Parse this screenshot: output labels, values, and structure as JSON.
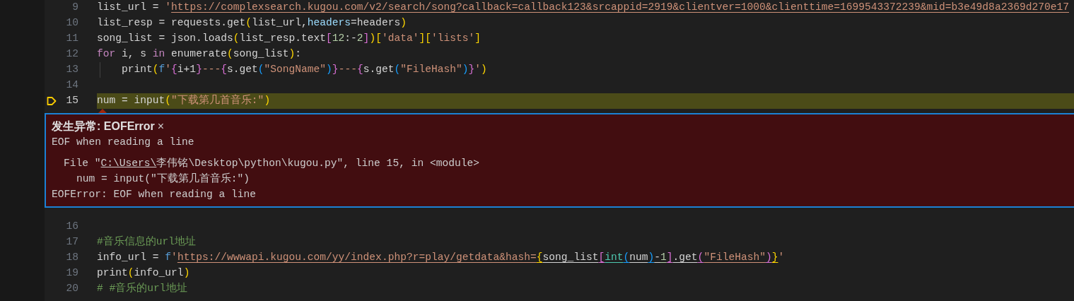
{
  "editor": {
    "lines_before": [
      {
        "number": "9",
        "current": false,
        "indent_guide": false,
        "segments": [
          {
            "text": "list_url = ",
            "kind": "plain"
          },
          {
            "text": "'",
            "kind": "string"
          },
          {
            "text": "https://complexsearch.kugou.com/v2/search/song?callback=callback123&srcappid=2919&clientver=1000&clienttime=1699543372239&mid=b3e49d8a2369d270e17",
            "kind": "string_link"
          }
        ]
      },
      {
        "number": "10",
        "current": false,
        "indent_guide": false,
        "segments": [
          {
            "text": "list_resp = requests.get",
            "kind": "plain"
          },
          {
            "text": "(",
            "kind": "bracket1"
          },
          {
            "text": "list_url,",
            "kind": "plain"
          },
          {
            "text": "headers",
            "kind": "param"
          },
          {
            "text": "=headers",
            "kind": "plain"
          },
          {
            "text": ")",
            "kind": "bracket1"
          }
        ]
      },
      {
        "number": "11",
        "current": false,
        "indent_guide": false,
        "segments": [
          {
            "text": "song_list = json.loads",
            "kind": "plain"
          },
          {
            "text": "(",
            "kind": "bracket1"
          },
          {
            "text": "list_resp.text",
            "kind": "plain"
          },
          {
            "text": "[",
            "kind": "bracket2"
          },
          {
            "text": "12",
            "kind": "number"
          },
          {
            "text": ":-",
            "kind": "plain"
          },
          {
            "text": "2",
            "kind": "number"
          },
          {
            "text": "]",
            "kind": "bracket2"
          },
          {
            "text": ")",
            "kind": "bracket1"
          },
          {
            "text": "[",
            "kind": "bracket1"
          },
          {
            "text": "'data'",
            "kind": "string"
          },
          {
            "text": "][",
            "kind": "bracket1"
          },
          {
            "text": "'lists'",
            "kind": "string"
          },
          {
            "text": "]",
            "kind": "bracket1"
          }
        ]
      },
      {
        "number": "12",
        "current": false,
        "indent_guide": false,
        "segments": [
          {
            "text": "for",
            "kind": "keyword"
          },
          {
            "text": " i, s ",
            "kind": "plain"
          },
          {
            "text": "in",
            "kind": "keyword"
          },
          {
            "text": " enumerate",
            "kind": "plain"
          },
          {
            "text": "(",
            "kind": "bracket1"
          },
          {
            "text": "song_list",
            "kind": "plain"
          },
          {
            "text": ")",
            "kind": "bracket1"
          },
          {
            "text": ":",
            "kind": "plain"
          }
        ]
      },
      {
        "number": "13",
        "current": false,
        "indent_guide": true,
        "segments": [
          {
            "text": "print",
            "kind": "plain"
          },
          {
            "text": "(",
            "kind": "bracket1"
          },
          {
            "text": "f",
            "kind": "fprefix"
          },
          {
            "text": "'",
            "kind": "string"
          },
          {
            "text": "{",
            "kind": "bracket2"
          },
          {
            "text": "i+1",
            "kind": "plain"
          },
          {
            "text": "}",
            "kind": "bracket2"
          },
          {
            "text": "---",
            "kind": "string"
          },
          {
            "text": "{",
            "kind": "bracket2"
          },
          {
            "text": "s.get",
            "kind": "plain"
          },
          {
            "text": "(",
            "kind": "bracket3"
          },
          {
            "text": "\"SongName\"",
            "kind": "string"
          },
          {
            "text": ")",
            "kind": "bracket3"
          },
          {
            "text": "}",
            "kind": "bracket2"
          },
          {
            "text": "---",
            "kind": "string"
          },
          {
            "text": "{",
            "kind": "bracket2"
          },
          {
            "text": "s.get",
            "kind": "plain"
          },
          {
            "text": "(",
            "kind": "bracket3"
          },
          {
            "text": "\"FileHash\"",
            "kind": "string"
          },
          {
            "text": ")",
            "kind": "bracket3"
          },
          {
            "text": "}",
            "kind": "bracket2"
          },
          {
            "text": "'",
            "kind": "string"
          },
          {
            "text": ")",
            "kind": "bracket1"
          }
        ]
      },
      {
        "number": "14",
        "current": false,
        "indent_guide": false
      },
      {
        "number": "15",
        "current": true,
        "indent_guide": false,
        "segments": [
          {
            "text": "num = input",
            "kind": "plain"
          },
          {
            "text": "(",
            "kind": "bracket1"
          },
          {
            "text": "\"下载第几首音乐:\"",
            "kind": "string"
          },
          {
            "text": ")",
            "kind": "bracket1"
          }
        ]
      }
    ],
    "exception": {
      "title": "发生异常: EOFError",
      "close": "×",
      "message": "EOF when reading a line",
      "traceback": [
        {
          "kind": "file",
          "prefix": "File \"",
          "link": "C:\\Users\\",
          "rest": "李伟铭\\Desktop\\python\\kugou.py\", line 15, in <module>"
        },
        {
          "kind": "source",
          "text": "num = input(\"下载第几首音乐:\")"
        }
      ],
      "summary": "EOFError: EOF when reading a line"
    },
    "lines_after": [
      {
        "number": "16",
        "current": false,
        "indent_guide": false
      },
      {
        "number": "17",
        "current": false,
        "indent_guide": false,
        "segments": [
          {
            "text": "#音乐信息的url地址",
            "kind": "comment"
          }
        ]
      },
      {
        "number": "18",
        "current": false,
        "indent_guide": false,
        "segments": [
          {
            "text": "info_url = ",
            "kind": "plain"
          },
          {
            "text": "f",
            "kind": "fprefix"
          },
          {
            "text": "'",
            "kind": "string"
          },
          {
            "text": "https://wwwapi.kugou.com/yy/index.php?r=play/getdata&hash=",
            "kind": "string_link"
          },
          {
            "text": "{",
            "kind": "bracket1_link"
          },
          {
            "text": "song_list",
            "kind": "plain_link"
          },
          {
            "text": "[",
            "kind": "bracket2_link"
          },
          {
            "text": "int",
            "kind": "builtin_link"
          },
          {
            "text": "(",
            "kind": "bracket3_link"
          },
          {
            "text": "num",
            "kind": "plain_link"
          },
          {
            "text": ")",
            "kind": "bracket3_link"
          },
          {
            "text": "-",
            "kind": "plain_link"
          },
          {
            "text": "1",
            "kind": "number_link"
          },
          {
            "text": "]",
            "kind": "bracket2_link"
          },
          {
            "text": ".get",
            "kind": "plain_link"
          },
          {
            "text": "(",
            "kind": "bracket2_link"
          },
          {
            "text": "\"FileHash\"",
            "kind": "string_link"
          },
          {
            "text": ")",
            "kind": "bracket2_link"
          },
          {
            "text": "}",
            "kind": "bracket1_link"
          },
          {
            "text": "'",
            "kind": "string"
          }
        ]
      },
      {
        "number": "19",
        "current": false,
        "indent_guide": false,
        "segments": [
          {
            "text": "print",
            "kind": "plain"
          },
          {
            "text": "(",
            "kind": "bracket1"
          },
          {
            "text": "info_url",
            "kind": "plain"
          },
          {
            "text": ")",
            "kind": "bracket1"
          }
        ]
      },
      {
        "number": "20",
        "current": false,
        "indent_guide": false,
        "segments": [
          {
            "text": "# #音乐的url地址",
            "kind": "comment"
          }
        ]
      }
    ]
  }
}
